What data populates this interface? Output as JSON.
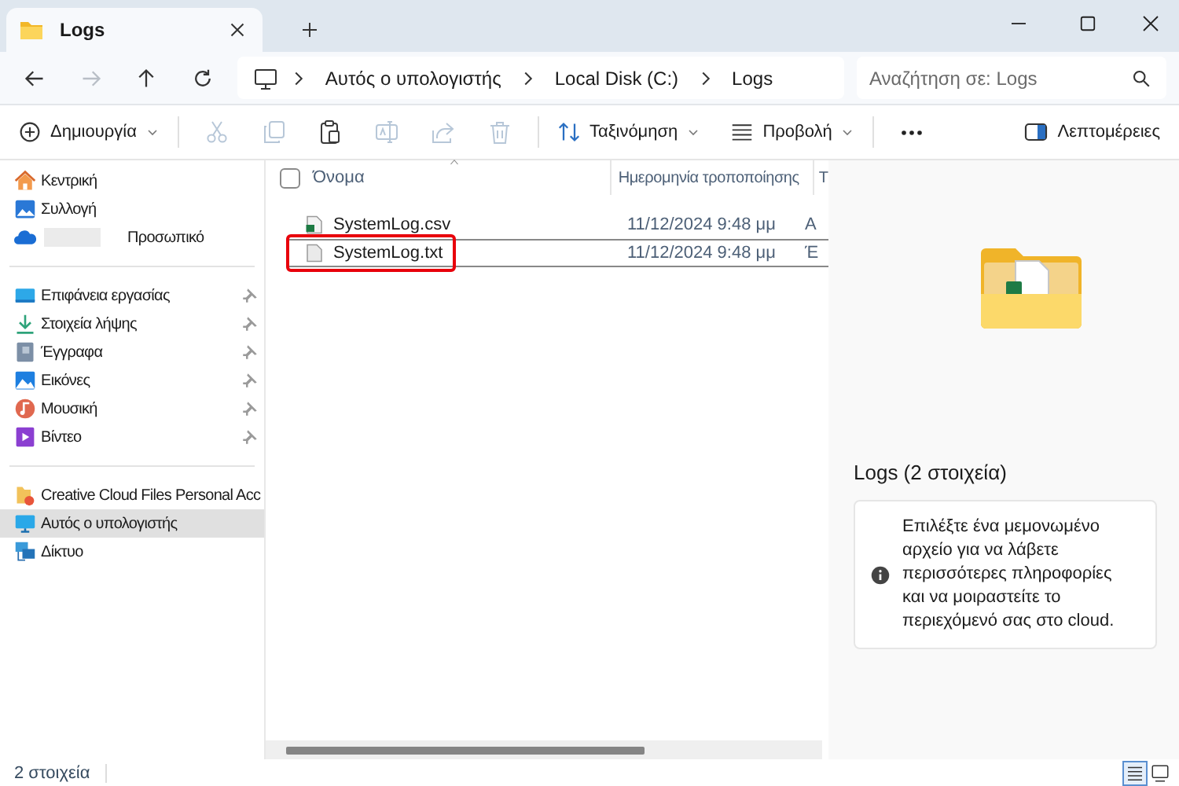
{
  "window": {
    "tab_title": "Logs"
  },
  "navigation": {
    "forward_disabled": true,
    "breadcrumbs": [
      "Αυτός ο υπολογιστής",
      "Local Disk (C:)",
      "Logs"
    ],
    "search": {
      "placeholder": "Αναζήτηση σε: Logs"
    }
  },
  "toolbar": {
    "new_label": "Δημιουργία",
    "actions": [
      {
        "disabled": true
      },
      {
        "disabled": true
      },
      {
        "disabled": false
      },
      {
        "disabled": true
      },
      {
        "disabled": true
      },
      {
        "disabled": true
      }
    ],
    "sort_label": "Ταξινόμηση",
    "view_label": "Προβολή",
    "details_label": "Λεπτομέρειες"
  },
  "sidebar": {
    "groups": [
      [
        {
          "label": "Κεντρική",
          "pinned": false,
          "selected": false
        },
        {
          "label": "Συλλογή",
          "pinned": false,
          "selected": false
        },
        {
          "label": "Προσωπικό",
          "pinned": false,
          "selected": false,
          "redacted": true
        }
      ],
      [
        {
          "label": "Επιφάνεια εργασίας",
          "pinned": true,
          "selected": false
        },
        {
          "label": "Στοιχεία λήψης",
          "pinned": true,
          "selected": false
        },
        {
          "label": "Έγγραφα",
          "pinned": true,
          "selected": false
        },
        {
          "label": "Εικόνες",
          "pinned": true,
          "selected": false
        },
        {
          "label": "Μουσική",
          "pinned": true,
          "selected": false
        },
        {
          "label": "Βίντεο",
          "pinned": true,
          "selected": false
        }
      ],
      [
        {
          "label": "Creative Cloud Files Personal Acc",
          "pinned": false,
          "selected": false
        },
        {
          "label": "Αυτός ο υπολογιστής",
          "pinned": false,
          "selected": true
        },
        {
          "label": "Δίκτυο",
          "pinned": false,
          "selected": false
        }
      ]
    ]
  },
  "file_list": {
    "select_all_checked": false,
    "columns": [
      "Όνομα",
      "Ημερομηνία τροποποίησης",
      "Τ"
    ],
    "rows": [
      {
        "kind": "spreadsheet",
        "name": "SystemLog.csv",
        "date": "11/12/2024 9:48 μμ",
        "column_3": "A",
        "selected": false,
        "annotated": false
      },
      {
        "kind": "text",
        "name": "SystemLog.txt",
        "date": "11/12/2024 9:48 μμ",
        "column_3": "Έ",
        "selected": true,
        "annotated": true
      }
    ]
  },
  "details": {
    "title": "Logs (2 στοιχεία)",
    "message": "Επιλέξτε ένα μεμονωμένο αρχείο για να λάβετε περισσότερες πληροφορίες και να μοιραστείτε το περιεχόμενό σας στο cloud."
  },
  "status_bar": {
    "count": "2 στοιχεία",
    "views": [
      {
        "kind": "details",
        "selected": true
      },
      {
        "kind": "tiles",
        "selected": false
      }
    ]
  }
}
